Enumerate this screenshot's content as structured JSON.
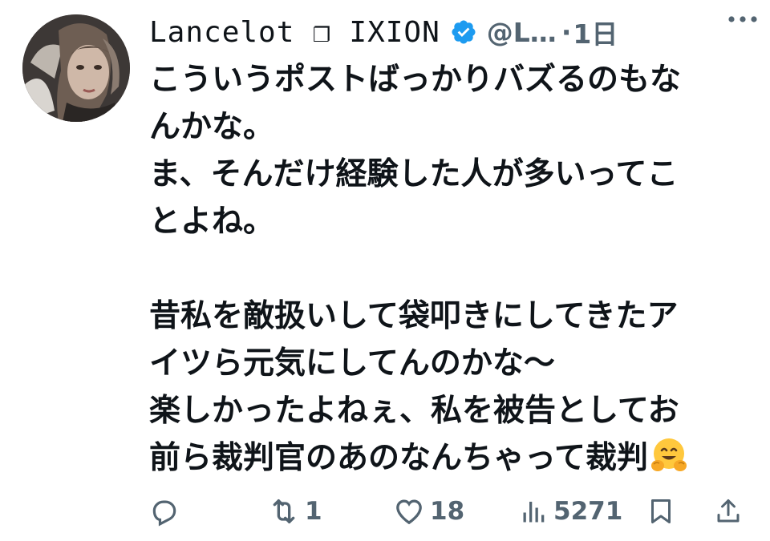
{
  "user": {
    "display_name": "Lancelot ❐ IXION",
    "handle": "@L…",
    "separator": "·",
    "time": "1日",
    "avatar_icon": "avatar-portrait",
    "verified_color": "#1d9bf0"
  },
  "post": {
    "lines": [
      "こういうポストばっかりバズるのもな",
      "んかな。",
      "ま、そんだけ経験した人が多いってこ",
      "とよね。",
      "",
      "昔私を敵扱いして袋叩きにしてきたア",
      "イツら元気にしてんのかな〜",
      "楽しかったよねぇ、私を被告としてお",
      "前ら裁判官のあのなんちゃって裁判"
    ],
    "trailing_emoji": "hugging-face-emoji"
  },
  "actions": {
    "reply": {
      "icon": "reply-icon",
      "count": ""
    },
    "repost": {
      "icon": "repost-icon",
      "count": "1"
    },
    "like": {
      "icon": "heart-icon",
      "count": "18"
    },
    "views": {
      "icon": "views-icon",
      "count": "5271"
    },
    "bookmark": {
      "icon": "bookmark-icon"
    },
    "share": {
      "icon": "share-icon"
    }
  },
  "colors": {
    "text": "#0f1419",
    "secondary": "#536471",
    "verified": "#1d9bf0",
    "emoji": "#ffc83d"
  }
}
